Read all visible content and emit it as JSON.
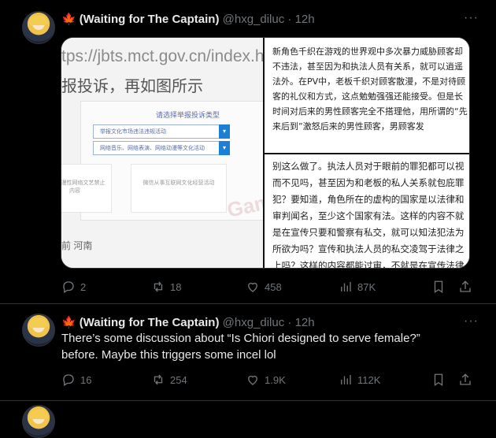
{
  "tweet1": {
    "author_emoji": "🍁",
    "display_name": "(Waiting for The Captain)",
    "handle": "@hxg_diluc",
    "dot": "·",
    "time": "12h",
    "more": "···",
    "media": {
      "url_text": "tps://jbts.mct.gov.cn/index.ht",
      "left_heading": "报投诉，再如图所示",
      "form_title": "请选择举报投诉类型",
      "select1": "举报文化市场违法违规活动",
      "select2": "网络音乐、网络表演、网络动漫等文化活动",
      "option1": "网络动漫性网络文艺禁止内容",
      "option2": "微信从事互联网文化经营活动",
      "footer": "前  河南",
      "watermark": "Gamek",
      "text_top": "新角色千织在游戏的世界观中多次暴力威胁顾客却不违法，甚至因为和执法人员有关系，就可以逍遥法外。在PV中，老板千织对顾客散漫，不是对待顾客的礼仪和方式，这点勉勉强强还能接受。但是长时间对后来的男性顾客完全不搭理他，用所谓的“先来后到”激怒后来的男性顾客，男顾客发",
      "text_bottom": "别这么做了。执法人员对于眼前的罪犯都可以视而不见吗，甚至因为和老板的私人关系就包庇罪犯？要知道，角色所在的虚构的国家是以法律和审判闻名，至少这个国家有法。这样的内容不就是在宣传只要和警察有私交，就可以知法犯法为所欲为吗？宣传和执法人员的私交凌驾于法律之上吗？这样的内容都能过审，不就是在宣传法律"
    },
    "actions": {
      "replies": "2",
      "reposts": "18",
      "likes": "458",
      "views": "87K"
    }
  },
  "tweet2": {
    "author_emoji": "🍁",
    "display_name": "(Waiting for The Captain)",
    "handle": "@hxg_diluc",
    "dot": "·",
    "time": "12h",
    "more": "···",
    "text_line1": "There’s some discussion about “Is Chiori designed to serve female?”",
    "text_line2": "before. Maybe this triggers some incel lol",
    "actions": {
      "replies": "16",
      "reposts": "254",
      "likes": "1.9K",
      "views": "112K"
    }
  },
  "colors": {
    "background": "#000000",
    "text": "#e7e9ea",
    "muted": "#71767b",
    "leaf": "#e0245e"
  },
  "icons": [
    "reply-icon",
    "repost-icon",
    "like-icon",
    "views-icon",
    "bookmark-icon",
    "share-icon"
  ]
}
